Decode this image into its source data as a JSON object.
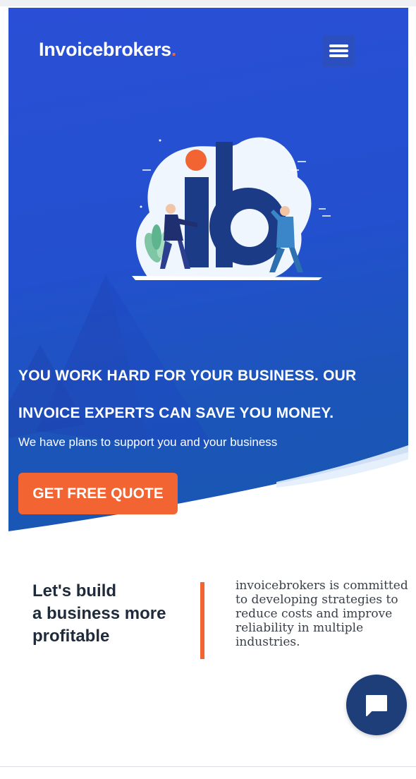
{
  "header": {
    "logo_text": "Invoicebrokers",
    "logo_dot": ".",
    "menu_icon": "hamburger-menu-icon"
  },
  "hero": {
    "illustration_icon": "ib-logo-illustration",
    "title_line1": "YOU WORK HARD FOR YOUR BUSINESS. OUR",
    "title_line2": "INVOICE EXPERTS CAN SAVE YOU MONEY.",
    "subtitle": "We have plans to support you and your business",
    "cta_label": "GET FREE QUOTE"
  },
  "about": {
    "heading_line1": "Let's build",
    "heading_line2": "a business more",
    "heading_line3": "profitable",
    "description": "invoicebrokers is committed to developing strategies to reduce costs and improve reliability in multiple industries."
  },
  "chat": {
    "icon": "chat-bubble-icon"
  },
  "colors": {
    "hero_blue": "#2350cf",
    "accent_orange": "#f26432",
    "chat_navy": "#1d3e78",
    "heading_dark": "#1f2b3a"
  }
}
